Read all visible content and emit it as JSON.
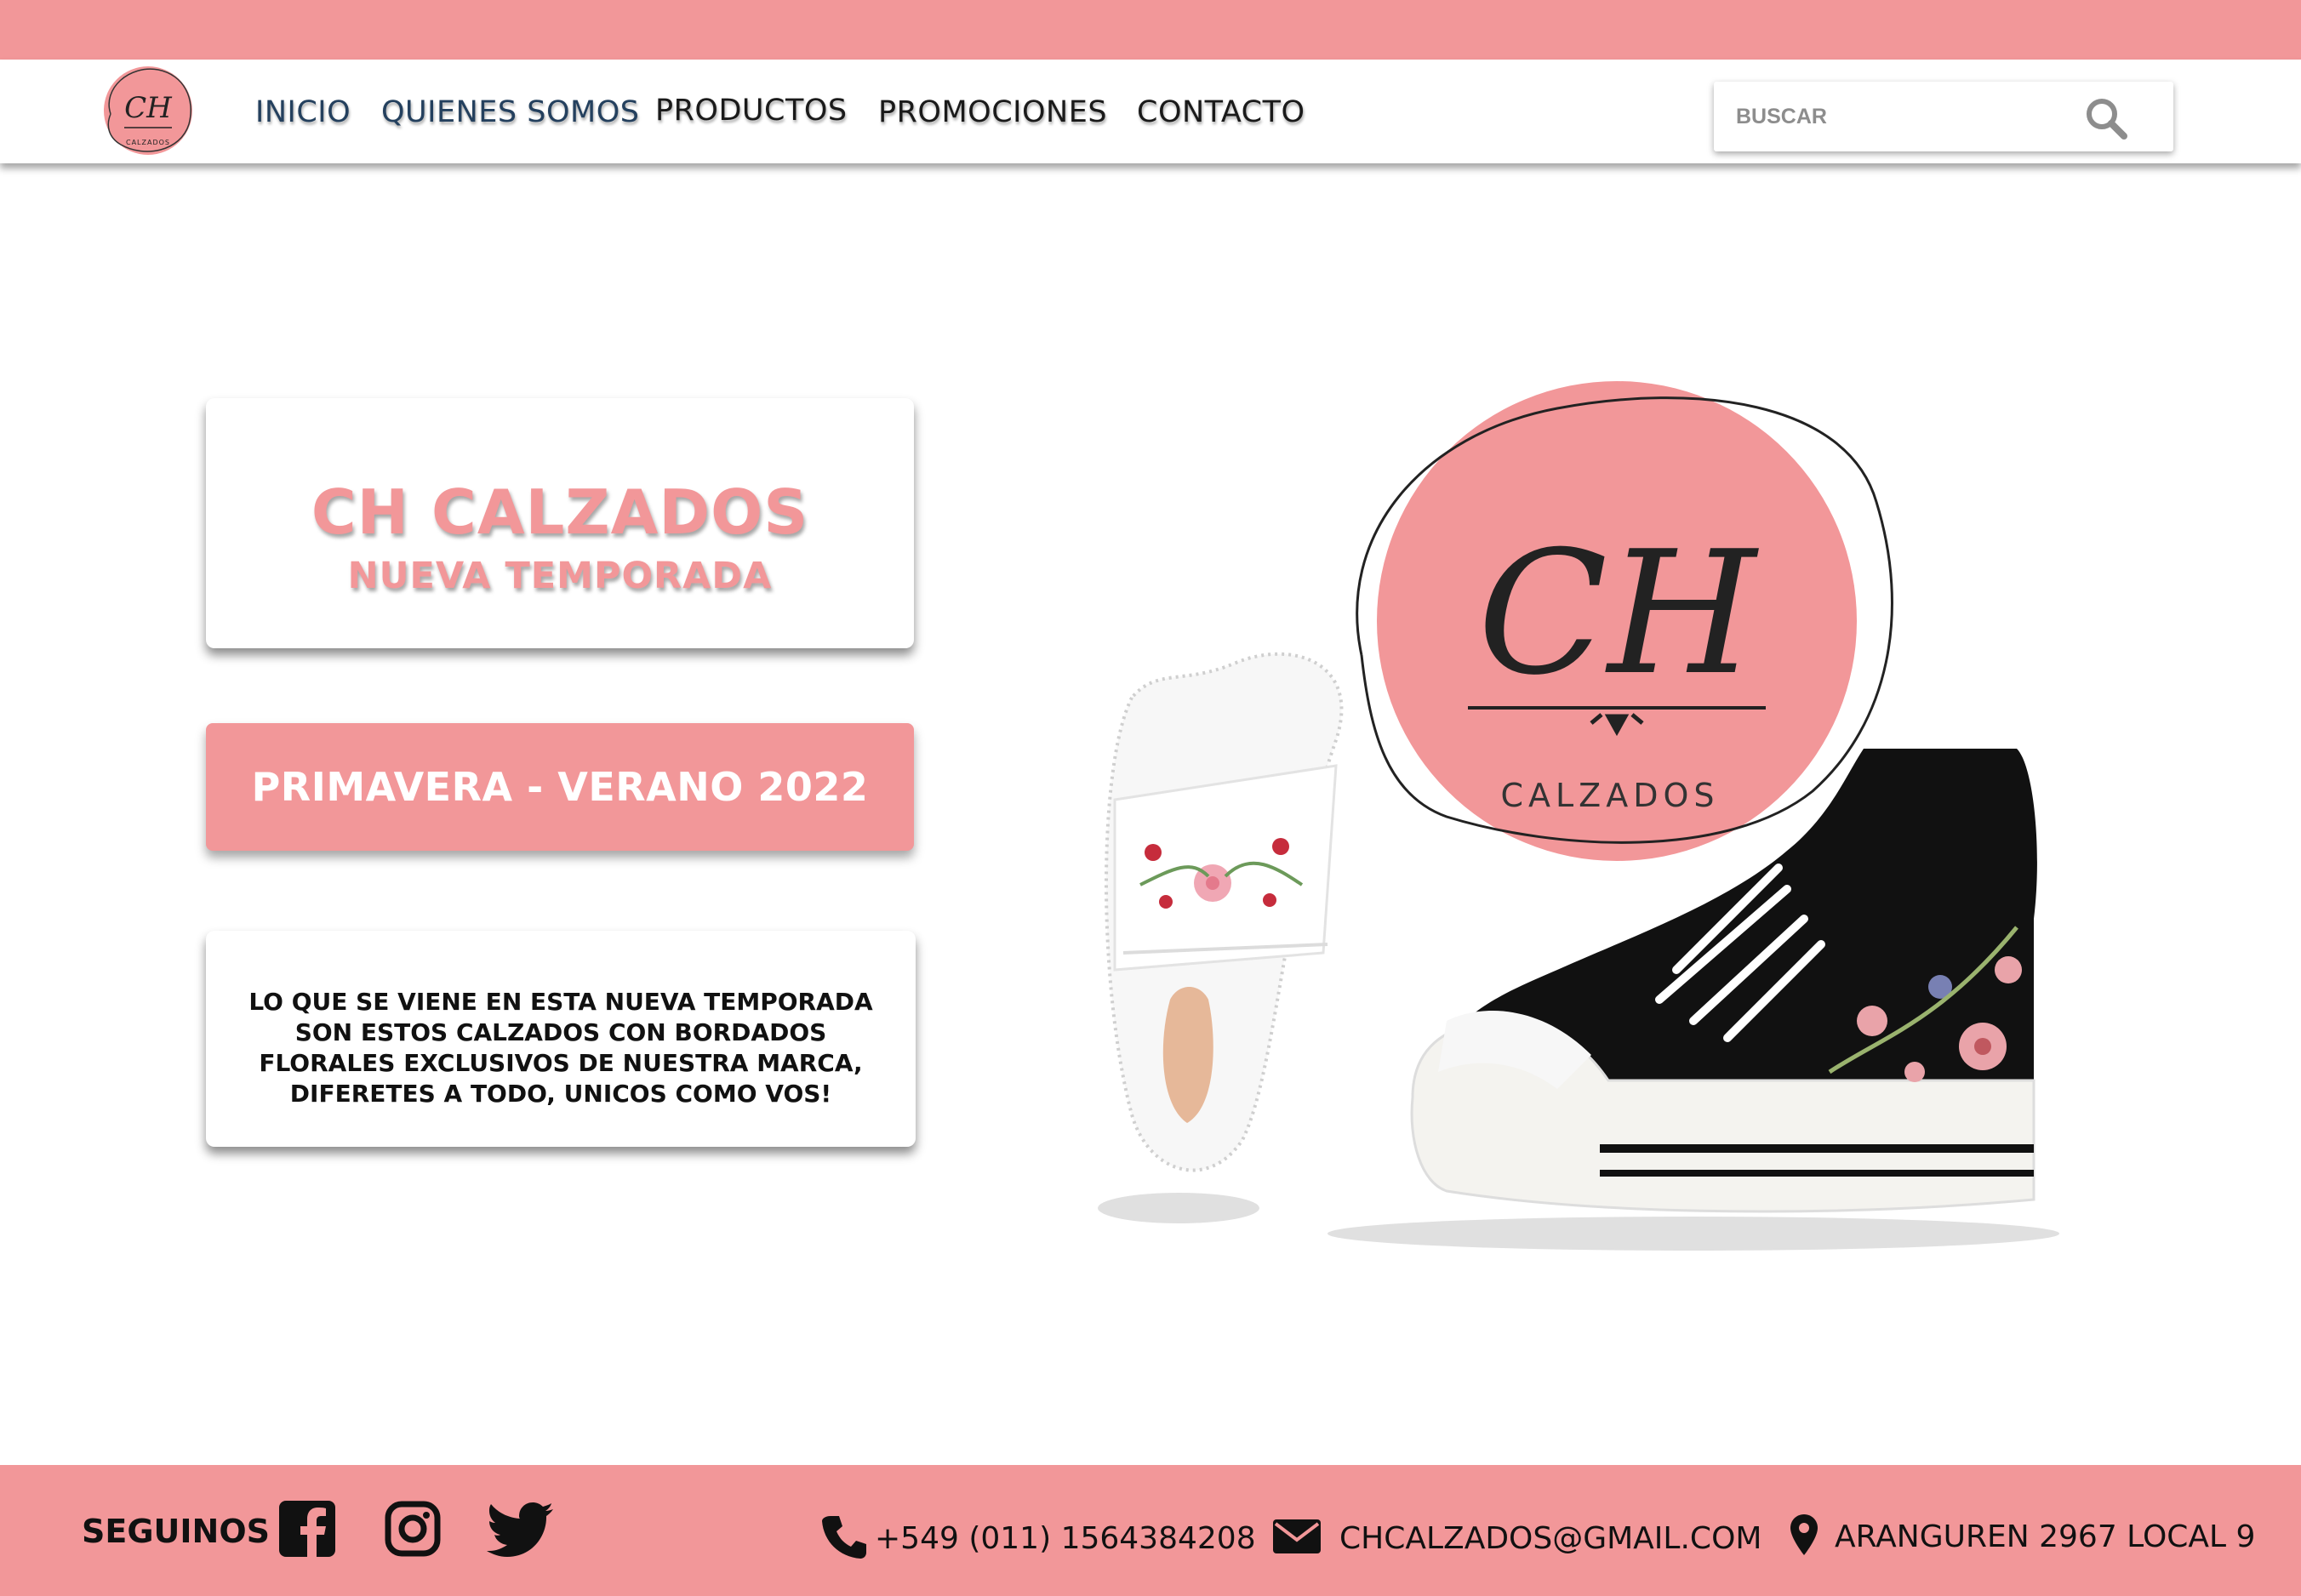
{
  "colors": {
    "brand_pink": "#f29799",
    "nav_blue": "#24405e",
    "text_dark": "#111111"
  },
  "logo": {
    "monogram": "CH",
    "wordmark": "CALZADOS"
  },
  "nav": {
    "items": [
      {
        "label": "INICIO"
      },
      {
        "label": "QUIENES SOMOS"
      },
      {
        "label": "PRODUCTOS"
      },
      {
        "label": "PROMOCIONES"
      },
      {
        "label": "CONTACTO"
      }
    ]
  },
  "search": {
    "placeholder": "BUSCAR",
    "icon": "search-icon"
  },
  "hero": {
    "title": "CH CALZADOS",
    "subtitle": "NUEVA TEMPORADA",
    "season_button": "PRIMAVERA - VERANO 2022",
    "description": "LO QUE SE VIENE EN ESTA NUEVA TEMPORADA SON ESTOS CALZADOS CON BORDADOS FLORALES EXCLUSIVOS DE NUESTRA MARCA, DIFERETES A TODO, UNICOS COMO VOS!"
  },
  "footer": {
    "follow_label": "SEGUINOS",
    "social": [
      "facebook-icon",
      "instagram-icon",
      "twitter-icon"
    ],
    "phone": "+549 (011) 1564384208",
    "email": "CHCALZADOS@GMAIL.COM",
    "address": "ARANGUREN 2967 LOCAL 9"
  }
}
